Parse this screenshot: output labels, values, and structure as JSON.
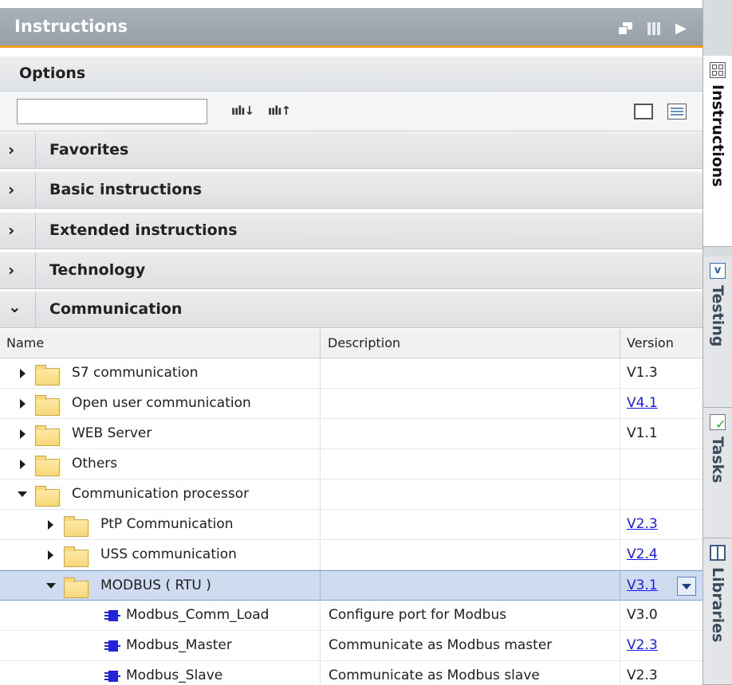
{
  "window": {
    "title": "Instructions"
  },
  "toolbar_icons": [
    "float-window-icon",
    "split-view-icon",
    "collapse-arrow-icon"
  ],
  "options": {
    "label": "Options",
    "search": {
      "value": "",
      "placeholder": ""
    },
    "search_down_label": "ıılı↓",
    "search_up_label": "ıılı↑"
  },
  "categories": [
    {
      "label": "Favorites",
      "expanded": false
    },
    {
      "label": "Basic instructions",
      "expanded": false
    },
    {
      "label": "Extended instructions",
      "expanded": false
    },
    {
      "label": "Technology",
      "expanded": false
    },
    {
      "label": "Communication",
      "expanded": true
    }
  ],
  "table": {
    "columns": {
      "name": "Name",
      "description": "Description",
      "version": "Version"
    },
    "rows": [
      {
        "name": "S7 communication",
        "description": "",
        "version": "V1.3",
        "version_link": false,
        "type": "folder",
        "level": 0,
        "expanded": false
      },
      {
        "name": "Open user communication",
        "description": "",
        "version": "V4.1",
        "version_link": true,
        "type": "folder",
        "level": 0,
        "expanded": false
      },
      {
        "name": "WEB Server",
        "description": "",
        "version": "V1.1",
        "version_link": false,
        "type": "folder",
        "level": 0,
        "expanded": false
      },
      {
        "name": "Others",
        "description": "",
        "version": "",
        "version_link": false,
        "type": "folder",
        "level": 0,
        "expanded": false
      },
      {
        "name": "Communication processor",
        "description": "",
        "version": "",
        "version_link": false,
        "type": "folder",
        "level": 0,
        "expanded": true
      },
      {
        "name": "PtP Communication",
        "description": "",
        "version": "V2.3",
        "version_link": true,
        "type": "folder",
        "level": 1,
        "expanded": false
      },
      {
        "name": "USS communication",
        "description": "",
        "version": "V2.4",
        "version_link": true,
        "type": "folder",
        "level": 1,
        "expanded": false
      },
      {
        "name": "MODBUS ( RTU )",
        "description": "",
        "version": "V3.1",
        "version_link": true,
        "type": "folder",
        "level": 1,
        "expanded": true,
        "selected": true
      },
      {
        "name": "Modbus_Comm_Load",
        "description": "Configure port for Modbus",
        "version": "V3.0",
        "version_link": false,
        "type": "block",
        "level": 2
      },
      {
        "name": "Modbus_Master",
        "description": "Communicate as Modbus master",
        "version": "V2.3",
        "version_link": true,
        "type": "block",
        "level": 2
      },
      {
        "name": "Modbus_Slave",
        "description": "Communicate as Modbus slave",
        "version": "V2.3",
        "version_link": false,
        "type": "block",
        "level": 2
      }
    ]
  },
  "side_tabs": [
    {
      "label": "Instructions",
      "icon": "instructions-grid-icon",
      "active": true
    },
    {
      "label": "Testing",
      "icon": "testing-icon",
      "active": false
    },
    {
      "label": "Tasks",
      "icon": "tasks-icon",
      "active": false
    },
    {
      "label": "Libraries",
      "icon": "libraries-icon",
      "active": false
    }
  ],
  "colors": {
    "accent": "#f29b1b",
    "link": "#1a1aee",
    "selection": "#cfdcef",
    "block_icon": "#2323d8"
  }
}
